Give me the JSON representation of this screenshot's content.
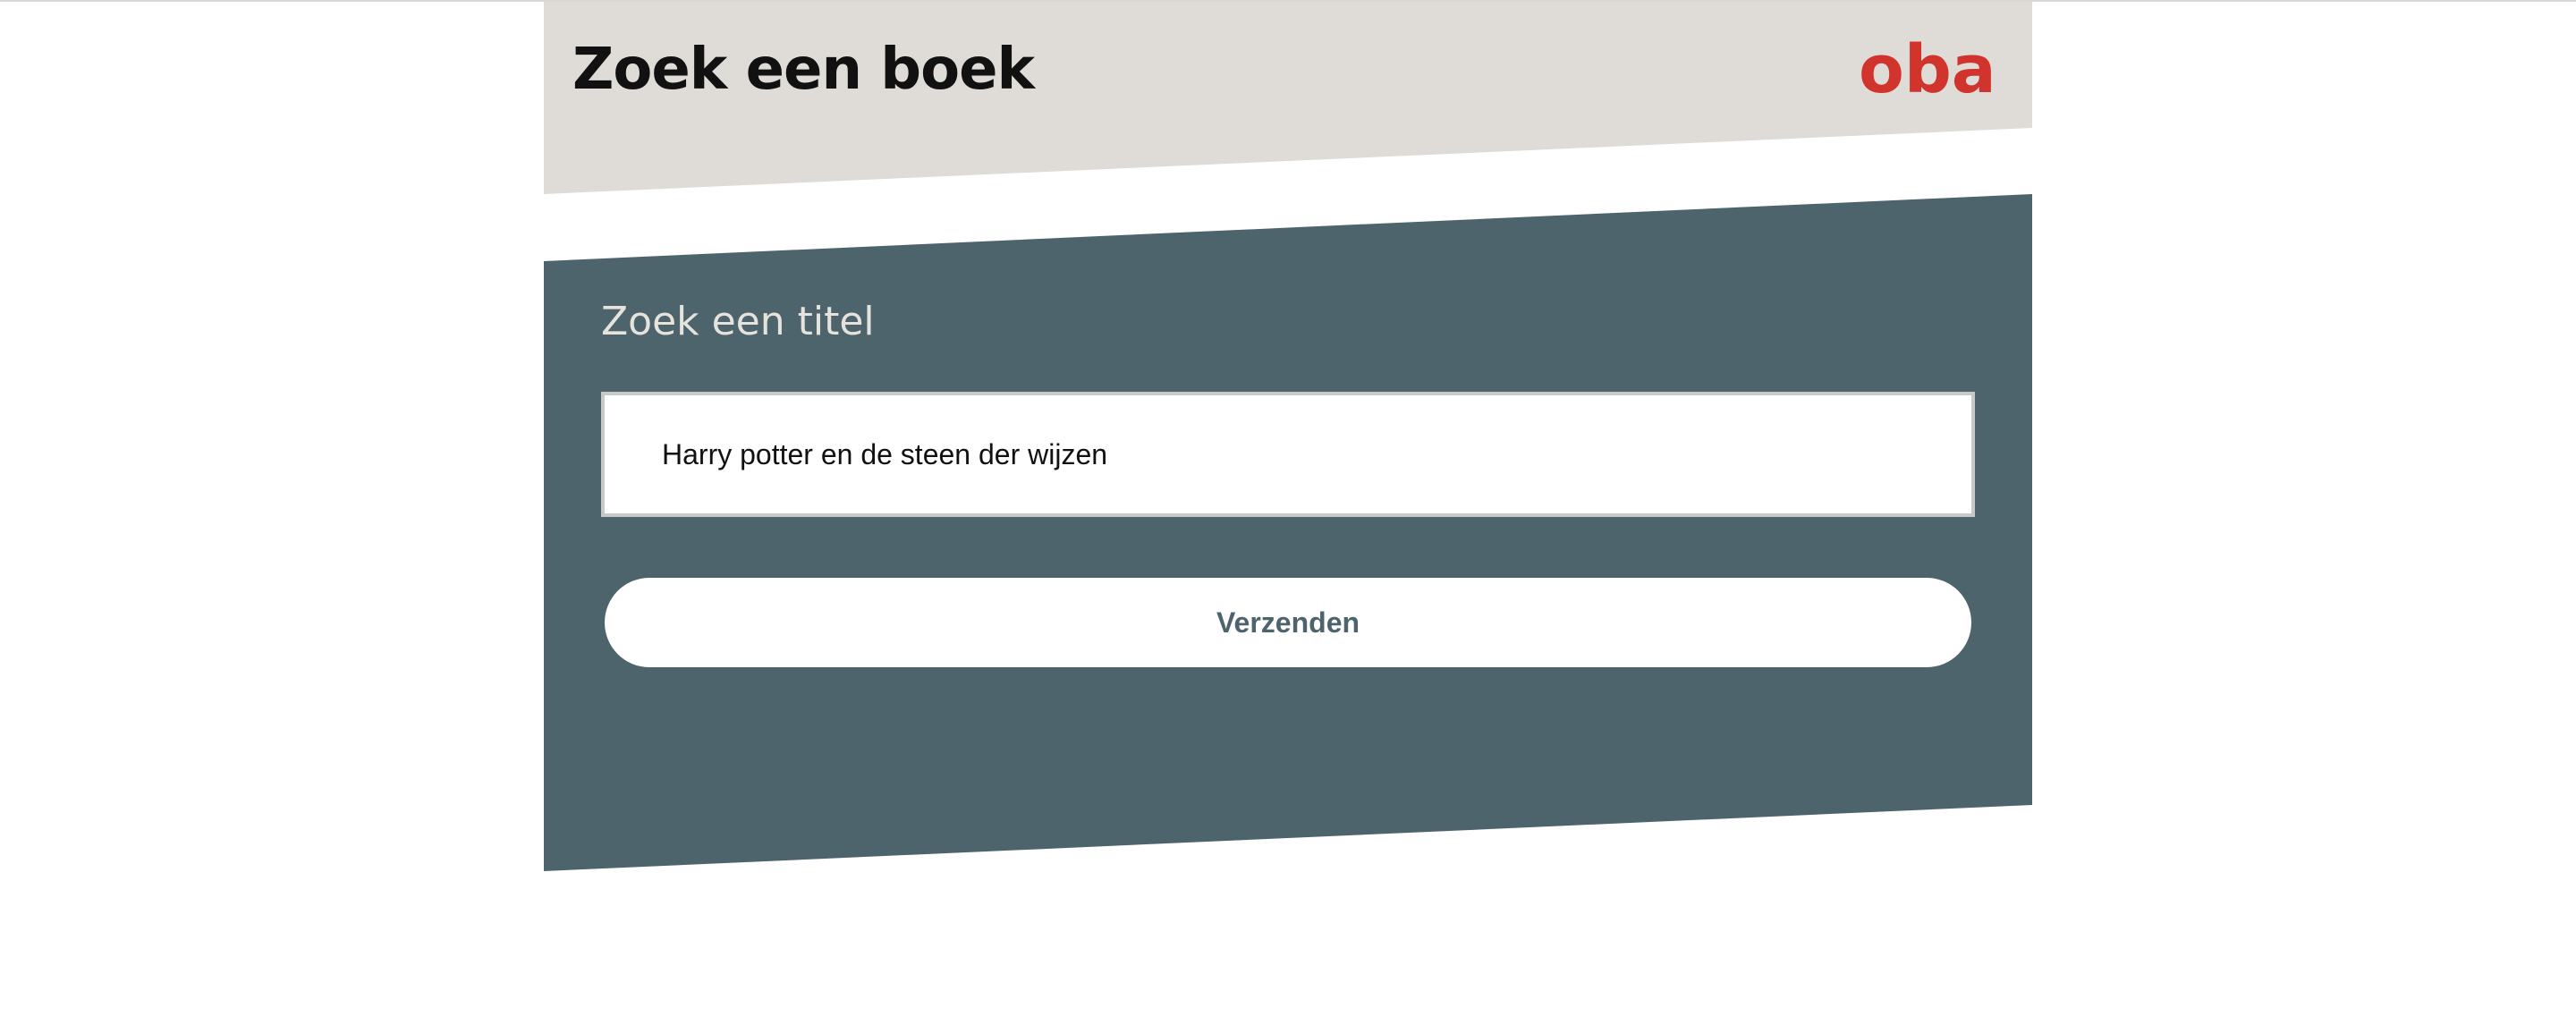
{
  "header": {
    "title": "Zoek een boek",
    "logo_text": "oba"
  },
  "form": {
    "label": "Zoek een titel",
    "input_value": "Harry potter en de steen der wijzen",
    "submit_label": "Verzenden"
  },
  "colors": {
    "header_background": "#dfdcd7",
    "panel_background": "#4e646c",
    "brand_red": "#d0342c",
    "button_text": "#4e646c"
  }
}
